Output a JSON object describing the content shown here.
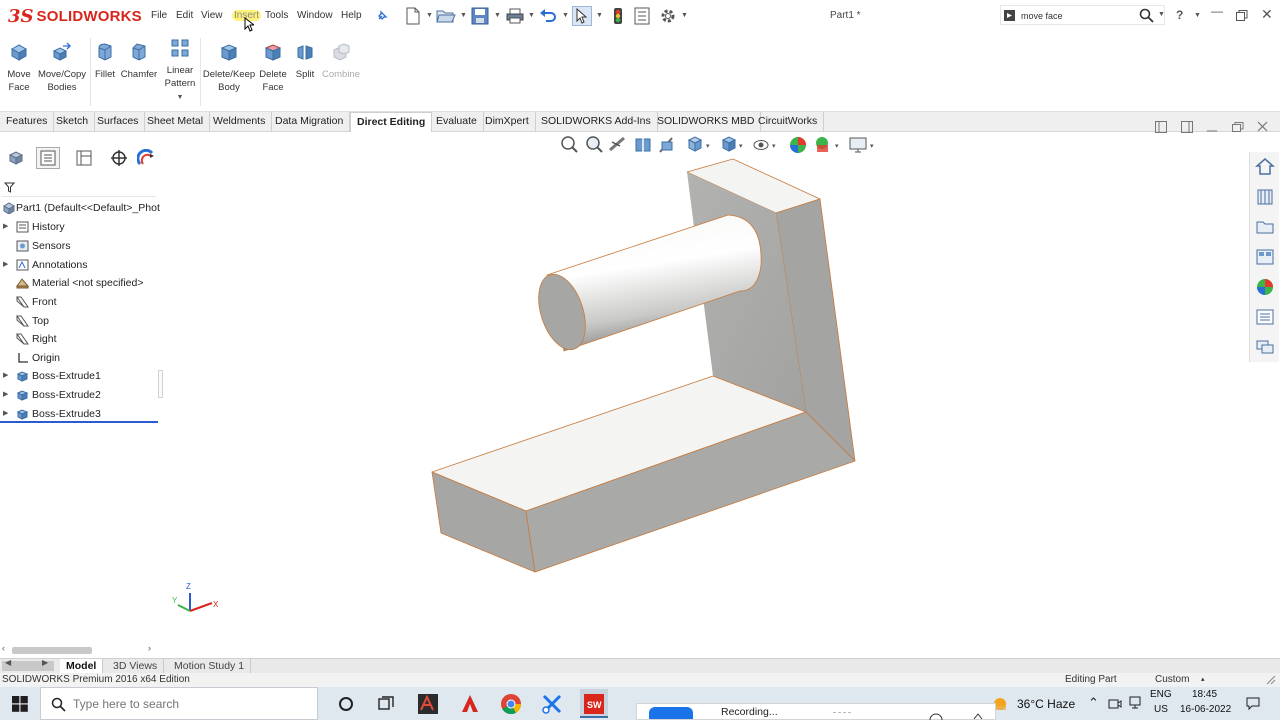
{
  "app": {
    "logo_mark": "3S",
    "logo_text": "SOLIDWORKS",
    "document_title": "Part1 *"
  },
  "menu": [
    "File",
    "Edit",
    "View",
    "Insert",
    "Tools",
    "Window",
    "Help"
  ],
  "search": {
    "value": "move face"
  },
  "command_manager": {
    "move_face": [
      "Move",
      "Face"
    ],
    "move_copy": [
      "Move/Copy",
      "Bodies"
    ],
    "fillet": "Fillet",
    "chamfer": "Chamfer",
    "linear_pattern": [
      "Linear",
      "Pattern"
    ],
    "delete_keep": [
      "Delete/Keep",
      "Body"
    ],
    "delete_face": [
      "Delete",
      "Face"
    ],
    "split": "Split",
    "combine": "Combine"
  },
  "tabs": [
    "Features",
    "Sketch",
    "Surfaces",
    "Sheet Metal",
    "Weldments",
    "Data Migration",
    "Direct Editing",
    "Evaluate",
    "DimXpert",
    "SOLIDWORKS Add-Ins",
    "SOLIDWORKS MBD",
    "CircuitWorks"
  ],
  "active_tab": "Direct Editing",
  "tree": {
    "root": "Part1  (Default<<Default>_Phot",
    "items": [
      "History",
      "Sensors",
      "Annotations",
      "Material <not specified>",
      "Front",
      "Top",
      "Right",
      "Origin",
      "Boss-Extrude1",
      "Boss-Extrude2",
      "Boss-Extrude3"
    ]
  },
  "bottom_tabs": [
    "Model",
    "3D Views",
    "Motion Study 1"
  ],
  "status": {
    "edition": "SOLIDWORKS Premium 2016 x64 Edition",
    "mode": "Editing Part",
    "units": "Custom"
  },
  "taskbar": {
    "search_placeholder": "Type here to search",
    "recording": "Recording...",
    "weather": "36°C  Haze",
    "lang": "ENG",
    "region": "US",
    "time": "18:45",
    "date": "16-06-2022"
  },
  "axes": {
    "x": "X",
    "y": "Y",
    "z": "Z"
  },
  "colors": {
    "brand_red": "#d9261c",
    "part_gray": "#a8a8a6",
    "part_light": "#f3f3f1",
    "edge": "#c8793a",
    "taskbar": "#dfe7ef",
    "selection_blue": "#2a5bd7"
  },
  "icons": [
    "pin-icon",
    "new-icon",
    "open-icon",
    "save-icon",
    "print-icon",
    "undo-icon",
    "select-icon",
    "rebuild-icon",
    "file-properties-icon",
    "options-icon",
    "search-icon",
    "help-icon",
    "windows-start-icon",
    "cortana-icon",
    "task-view-icon",
    "chrome-icon",
    "solidworks-icon"
  ]
}
